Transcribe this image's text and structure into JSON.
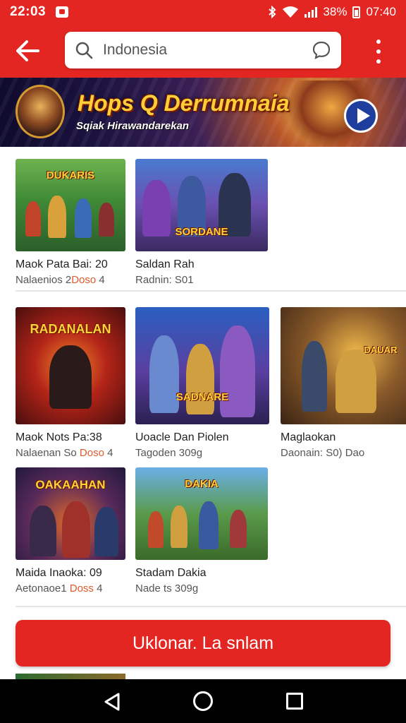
{
  "status_bar": {
    "time": "22:03",
    "battery": "38%",
    "battery_time": "07:40"
  },
  "app_bar": {
    "search_text": "Indonesia"
  },
  "banner": {
    "title": "Hops Q Derrumnaia",
    "subtitle": "Sqiak Hirawandarekan"
  },
  "games": [
    {
      "name": "Maok Pata Bai: 20",
      "meta_prefix": "Nalaenios 2",
      "meta_highlight": "Doso",
      "meta_suffix": " 4",
      "logo": "DUKARIS"
    },
    {
      "name": "Saldan Rah",
      "meta_prefix": "Radnin: S01",
      "meta_highlight": "",
      "meta_suffix": "",
      "logo": "SORDANE"
    },
    {
      "name": "Maok Nots Pa:38",
      "meta_prefix": "Nalaenan So ",
      "meta_highlight": "Doso",
      "meta_suffix": " 4",
      "logo": "RADANALAN"
    },
    {
      "name": "Uoacle Dan Piolen",
      "meta_prefix": "Tagoden 309g",
      "meta_highlight": "",
      "meta_suffix": "",
      "logo": "SADNARE"
    },
    {
      "name": "Maglaokan",
      "meta_prefix": "Daonain: S0) Dao",
      "meta_highlight": "",
      "meta_suffix": "",
      "logo": "DAUAR"
    },
    {
      "name": "Maida Inaoka: 09",
      "meta_prefix": "Aetonaoe1 ",
      "meta_highlight": "Doss",
      "meta_suffix": " 4",
      "logo": "OAKAAHAN"
    },
    {
      "name": "Stadam Dakia",
      "meta_prefix": "Nade ts 309g",
      "meta_highlight": "",
      "meta_suffix": "",
      "logo": "DAKIA"
    }
  ],
  "cta": {
    "label": "Uklonar. La snlam"
  },
  "colors": {
    "brand_red": "#e32622",
    "highlight_orange": "#e05a2a"
  },
  "icons": {
    "back": "arrow-left-icon",
    "search": "search-icon",
    "chat": "chat-bubble-icon",
    "more": "more-vertical-icon",
    "play": "play-icon"
  }
}
